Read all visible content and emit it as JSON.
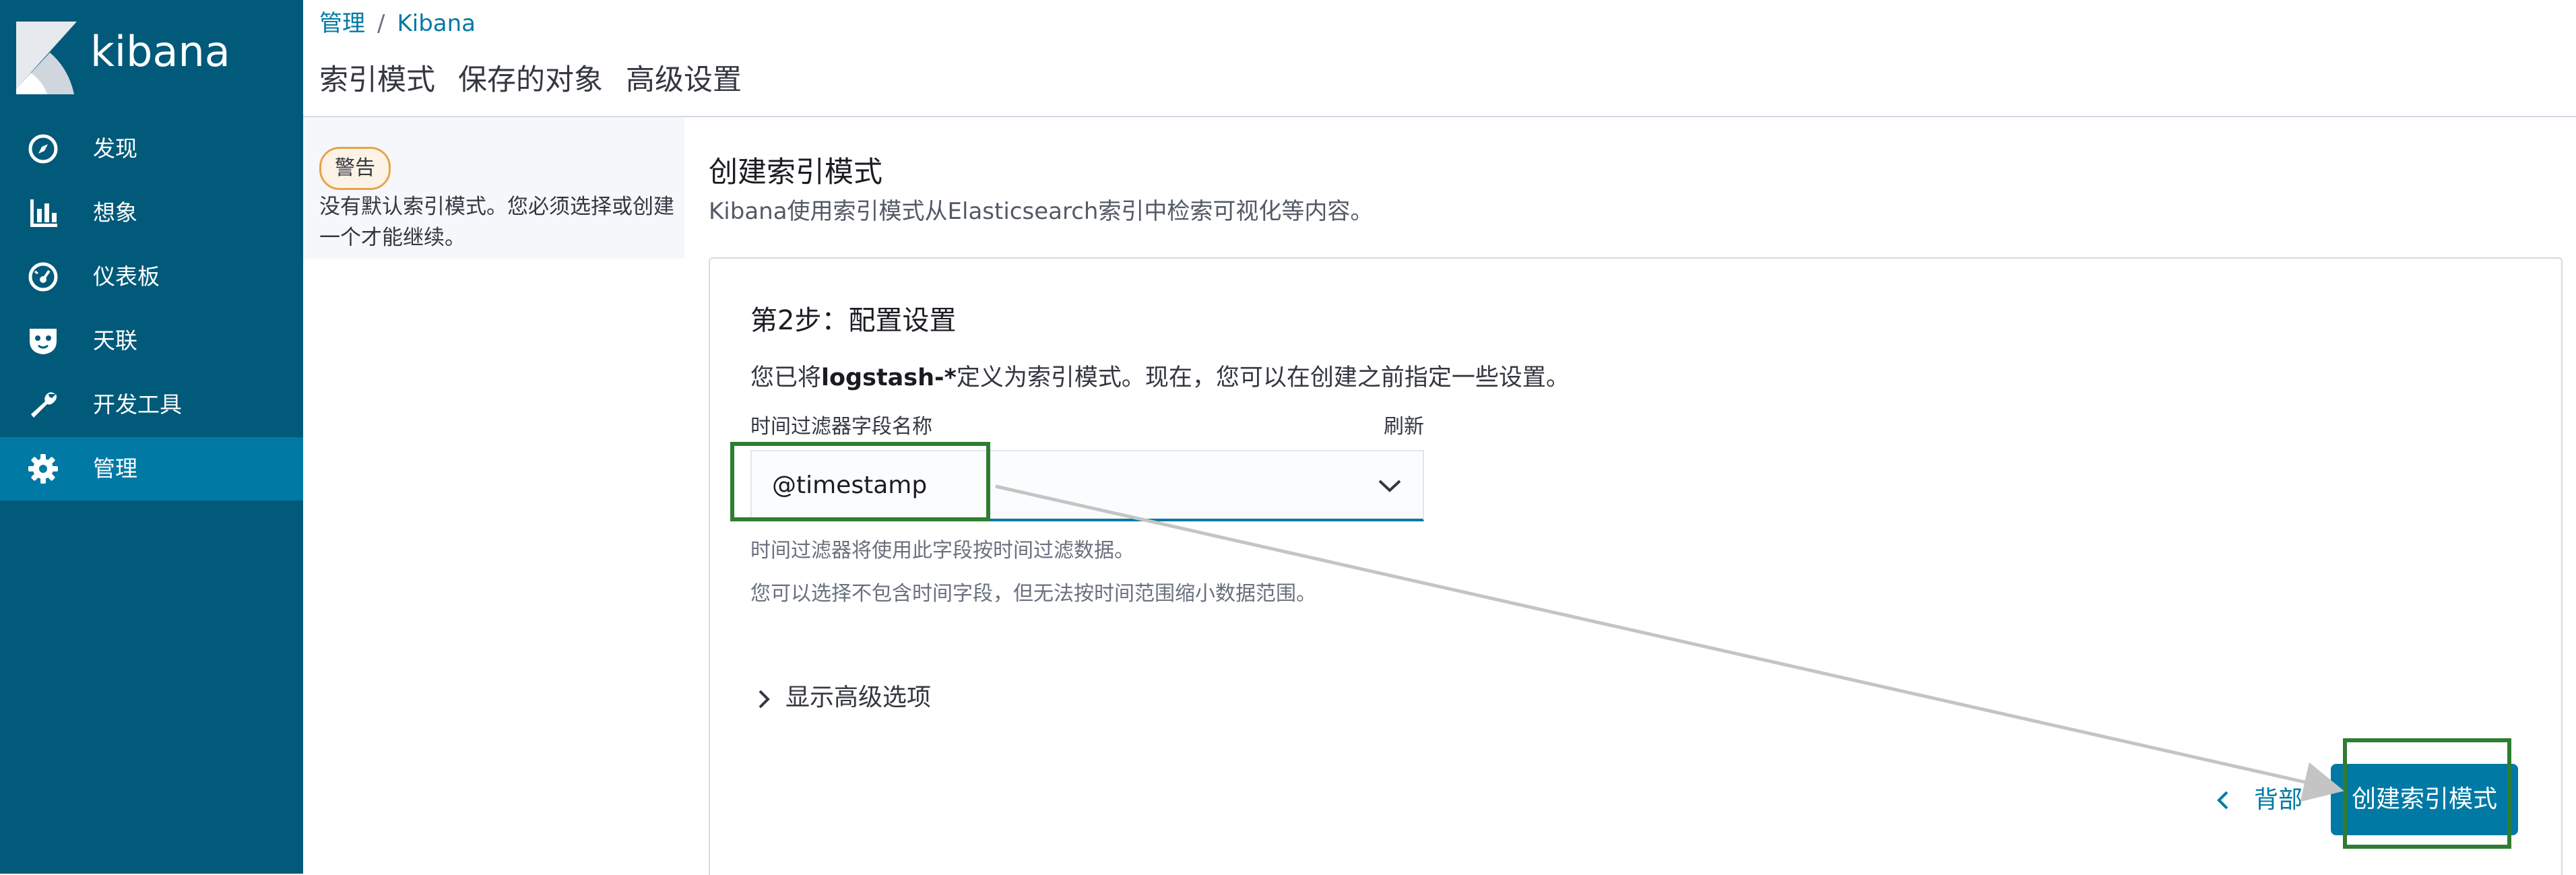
{
  "sidebar": {
    "logo_text": "kibana",
    "items": [
      {
        "label": "发现",
        "icon": "compass-icon"
      },
      {
        "label": "想象",
        "icon": "bar-chart-icon"
      },
      {
        "label": "仪表板",
        "icon": "dashboard-gauge-icon"
      },
      {
        "label": "天联",
        "icon": "badge-icon"
      },
      {
        "label": "开发工具",
        "icon": "wrench-icon"
      },
      {
        "label": "管理",
        "icon": "gear-icon",
        "active": true
      }
    ]
  },
  "breadcrumb": {
    "root": "管理",
    "separator": "/",
    "current": "Kibana"
  },
  "tabs": [
    "索引模式",
    "保存的对象",
    "高级设置"
  ],
  "warning": {
    "badge": "警告",
    "text": "没有默认索引模式。您必须选择或创建一个才能继续。"
  },
  "main": {
    "title": "创建索引模式",
    "description": "Kibana使用索引模式从Elasticsearch索引中检索可视化等内容。"
  },
  "step": {
    "title": "第2步：配置设置",
    "desc_prefix": "您已将",
    "desc_pattern": "logstash-*",
    "desc_suffix": "定义为索引模式。现在，您可以在创建之前指定一些设置。",
    "field_label": "时间过滤器字段名称",
    "refresh_label": "刷新",
    "select_value": "@timestamp",
    "help_text_1": "时间过滤器将使用此字段按时间过滤数据。",
    "help_text_2": "您可以选择不包含时间字段，但无法按时间范围缩小数据范围。",
    "advanced_toggle": "显示高级选项"
  },
  "actions": {
    "back_label": "背部",
    "create_label": "创建索引模式"
  },
  "colors": {
    "sidebar_bg": "#015a7a",
    "active_item_bg": "#0079a5",
    "primary": "#0079a5",
    "highlight_box": "#2e7d32",
    "warning_border": "#e7a34c"
  }
}
